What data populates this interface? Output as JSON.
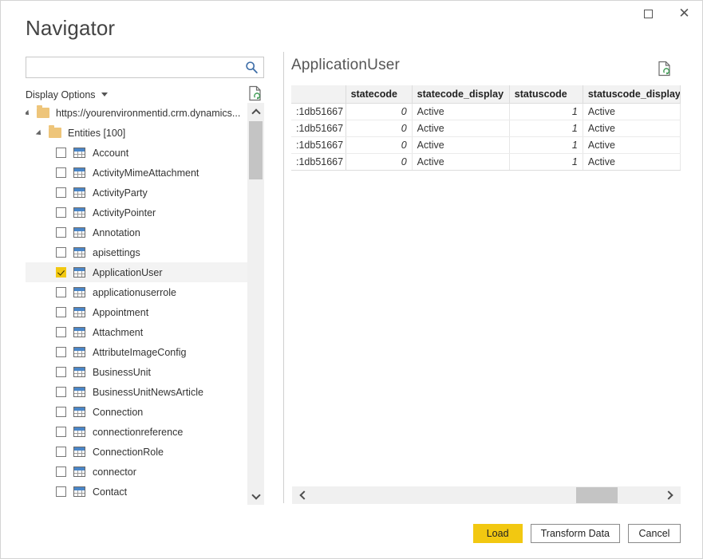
{
  "window": {
    "title": "Navigator",
    "maximize_icon": "maximize-icon",
    "close_icon": "close-icon"
  },
  "search": {
    "value": "",
    "placeholder": "",
    "icon": "search-icon"
  },
  "display_options": {
    "label": "Display Options",
    "caret_icon": "chevron-down-icon",
    "refresh_icon": "refresh-document-icon"
  },
  "tree": {
    "root": {
      "label": "https://yourenvironmentid.crm.dynamics...",
      "icon": "folder-icon",
      "expanded": true
    },
    "group": {
      "label": "Entities [100]",
      "icon": "folder-icon",
      "expanded": true
    },
    "items": [
      {
        "label": "Account",
        "checked": false,
        "icon": "table-icon"
      },
      {
        "label": "ActivityMimeAttachment",
        "checked": false,
        "icon": "table-icon"
      },
      {
        "label": "ActivityParty",
        "checked": false,
        "icon": "table-icon"
      },
      {
        "label": "ActivityPointer",
        "checked": false,
        "icon": "table-icon"
      },
      {
        "label": "Annotation",
        "checked": false,
        "icon": "table-icon"
      },
      {
        "label": "apisettings",
        "checked": false,
        "icon": "table-icon"
      },
      {
        "label": "ApplicationUser",
        "checked": true,
        "icon": "table-icon"
      },
      {
        "label": "applicationuserrole",
        "checked": false,
        "icon": "table-icon"
      },
      {
        "label": "Appointment",
        "checked": false,
        "icon": "table-icon"
      },
      {
        "label": "Attachment",
        "checked": false,
        "icon": "table-icon"
      },
      {
        "label": "AttributeImageConfig",
        "checked": false,
        "icon": "table-icon"
      },
      {
        "label": "BusinessUnit",
        "checked": false,
        "icon": "table-icon"
      },
      {
        "label": "BusinessUnitNewsArticle",
        "checked": false,
        "icon": "table-icon"
      },
      {
        "label": "Connection",
        "checked": false,
        "icon": "table-icon"
      },
      {
        "label": "connectionreference",
        "checked": false,
        "icon": "table-icon"
      },
      {
        "label": "ConnectionRole",
        "checked": false,
        "icon": "table-icon"
      },
      {
        "label": "connector",
        "checked": false,
        "icon": "table-icon"
      },
      {
        "label": "Contact",
        "checked": false,
        "icon": "table-icon"
      }
    ],
    "scrollbar": {
      "up_icon": "chevron-up-icon",
      "down_icon": "chevron-down-icon"
    }
  },
  "preview": {
    "title": "ApplicationUser",
    "refresh_icon": "refresh-document-icon",
    "columns": [
      "",
      "statecode",
      "statecode_display",
      "statuscode",
      "statuscode_display"
    ],
    "rows": [
      {
        "id": ":1db51667",
        "statecode": "0",
        "statecode_display": "Active",
        "statuscode": "1",
        "statuscode_display": "Active"
      },
      {
        "id": ":1db51667",
        "statecode": "0",
        "statecode_display": "Active",
        "statuscode": "1",
        "statuscode_display": "Active"
      },
      {
        "id": ":1db51667",
        "statecode": "0",
        "statecode_display": "Active",
        "statuscode": "1",
        "statuscode_display": "Active"
      },
      {
        "id": ":1db51667",
        "statecode": "0",
        "statecode_display": "Active",
        "statuscode": "1",
        "statuscode_display": "Active"
      }
    ],
    "hscrollbar": {
      "left_icon": "chevron-left-icon",
      "right_icon": "chevron-right-icon"
    }
  },
  "footer": {
    "load_label": "Load",
    "transform_label": "Transform Data",
    "cancel_label": "Cancel"
  },
  "colors": {
    "accent_yellow": "#f2c811",
    "folder": "#eec57a",
    "search_icon_blue": "#3e6ea8",
    "header_bg": "#f2f2f2",
    "selected_row": "#f3f3f3"
  }
}
